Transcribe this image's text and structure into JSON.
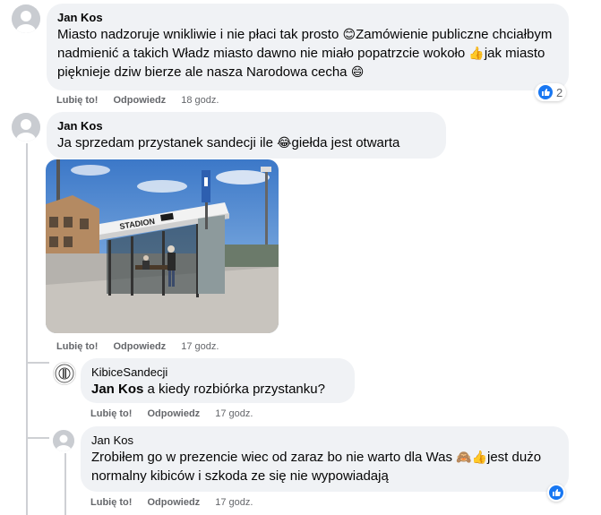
{
  "comments": [
    {
      "author": "Jan Kos",
      "text_part1": "Miasto nadzoruje wnikliwie i nie płaci tak prosto ",
      "emoji1": "😊",
      "text_part2": "Zamówienie publiczne chciałbym nadmienić a takich Władz miasto dawno nie miało popatrzcie wokoło ",
      "emoji2": "👍",
      "text_part3": "jak miasto pięknieje dziw bierze ale nasza Narodowa cecha ",
      "emoji3": "😄",
      "like_label": "Lubię to!",
      "reply_label": "Odpowiedz",
      "time": "18 godz.",
      "reaction_count": "2"
    },
    {
      "author": "Jan Kos",
      "text_part1": "Ja sprzedam przystanek sandecji ile ",
      "emoji1": "😂",
      "text_part2": "giełda jest otwarta",
      "photo_sign": "STADION",
      "like_label": "Lubię to!",
      "reply_label": "Odpowiedz",
      "time": "17 godz."
    }
  ],
  "replies": [
    {
      "author": "KibiceSandecji",
      "mention": "Jan Kos",
      "text": " a kiedy rozbiórka przystanku?",
      "like_label": "Lubię to!",
      "reply_label": "Odpowiedz",
      "time": "17 godz."
    },
    {
      "author": "Jan Kos",
      "text_part1": "Zrobiłem go w prezencie wiec od zaraz bo nie warto dla Was ",
      "emoji1": "🙈",
      "emoji2": "👍",
      "text_part2": "jest dużo normalny kibiców i szkoda ze się nie wypowiadają",
      "like_label": "Lubię to!",
      "reply_label": "Odpowiedz",
      "time": "17 godz."
    }
  ],
  "colors": {
    "bubble": "#f0f2f5",
    "like_blue": "#1877f2",
    "meta_gray": "#65676b"
  }
}
